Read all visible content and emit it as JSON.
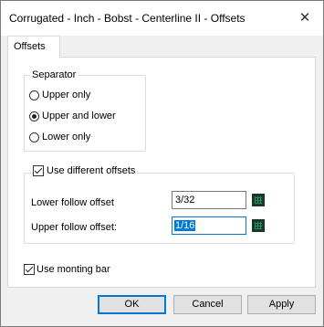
{
  "window": {
    "title": "Corrugated - Inch - Bobst - Centerline II - Offsets",
    "close_glyph": "✕"
  },
  "tabs": [
    {
      "label": "Offsets"
    }
  ],
  "separator": {
    "legend": "Separator",
    "options": [
      {
        "label": "Upper only",
        "selected": false
      },
      {
        "label": "Upper and lower",
        "selected": true
      },
      {
        "label": "Lower only",
        "selected": false
      }
    ]
  },
  "offsets": {
    "use_different_label": "Use different offsets",
    "use_different_checked": true,
    "lower_label": "Lower follow offset",
    "lower_value": "3/32",
    "upper_label": "Upper follow offset:",
    "upper_value": "1/16"
  },
  "monting_bar": {
    "label": "Use monting bar",
    "checked": true
  },
  "buttons": {
    "ok": "OK",
    "cancel": "Cancel",
    "apply": "Apply"
  }
}
